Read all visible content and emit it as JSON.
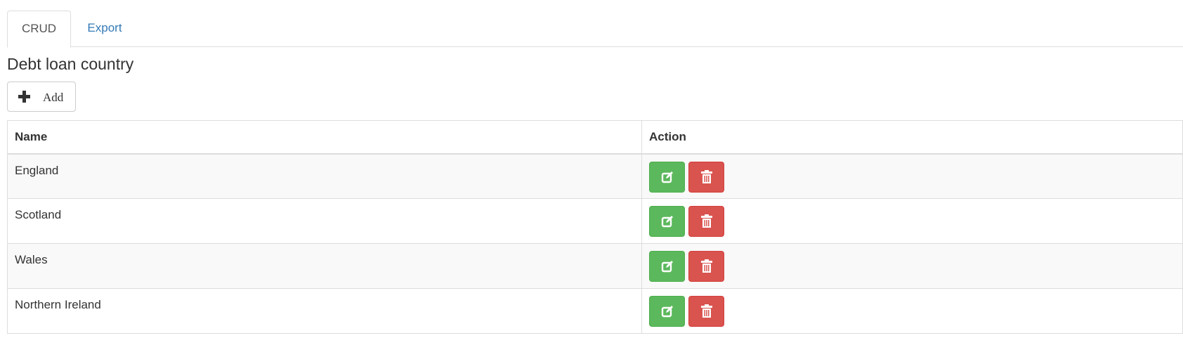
{
  "tabs": [
    {
      "label": "CRUD",
      "active": true
    },
    {
      "label": "Export",
      "active": false
    }
  ],
  "page": {
    "title": "Debt loan country"
  },
  "toolbar": {
    "add_label": "Add",
    "add_icon": "plus-icon"
  },
  "table": {
    "headers": {
      "name": "Name",
      "action": "Action"
    },
    "rows": [
      {
        "name": "England"
      },
      {
        "name": "Scotland"
      },
      {
        "name": "Wales"
      },
      {
        "name": "Northern Ireland"
      }
    ],
    "row_actions": {
      "edit_icon": "edit-icon",
      "delete_icon": "trash-icon"
    }
  },
  "colors": {
    "link": "#337ab7",
    "success": "#5cb85c",
    "danger": "#d9534f",
    "border": "#dddddd",
    "stripe": "#f9f9f9"
  }
}
